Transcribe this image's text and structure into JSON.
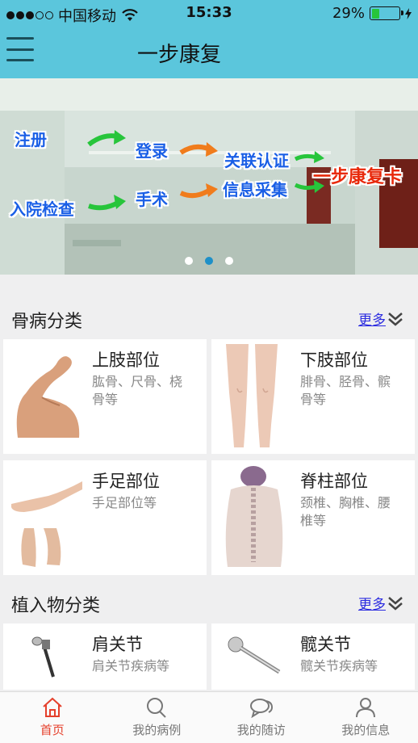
{
  "status_bar": {
    "carrier": "中国移动",
    "time": "15:33",
    "battery": "29%",
    "battery_level": 0.29
  },
  "header": {
    "title": "一步康复"
  },
  "banner": {
    "steps": [
      "注册",
      "登录",
      "入院检查",
      "手术",
      "关联认证",
      "信息采集",
      "一步康复卡"
    ],
    "pages": 3,
    "active_page": 2
  },
  "sections": [
    {
      "title": "骨病分类",
      "more": "更多",
      "cards": [
        {
          "title": "上肢部位",
          "desc": "肱骨、尺骨、桡骨等"
        },
        {
          "title": "下肢部位",
          "desc": "腓骨、胫骨、髌骨等"
        },
        {
          "title": "手足部位",
          "desc": "手足部位等"
        },
        {
          "title": "脊柱部位",
          "desc": "颈椎、胸椎、腰椎等"
        }
      ]
    },
    {
      "title": "植入物分类",
      "more": "更多",
      "cards": [
        {
          "title": "肩关节",
          "desc": "肩关节疾病等"
        },
        {
          "title": "髋关节",
          "desc": "髋关节疾病等"
        }
      ]
    }
  ],
  "tabbar": {
    "items": [
      {
        "label": "首页",
        "icon": "home-icon",
        "active": true
      },
      {
        "label": "我的病例",
        "icon": "search-icon"
      },
      {
        "label": "我的随访",
        "icon": "chat-icon"
      },
      {
        "label": "我的信息",
        "icon": "person-icon"
      }
    ]
  },
  "colors": {
    "header": "#5bc6dc",
    "active_tab": "#e5402c",
    "link": "#2b2be0",
    "pager_active": "#1e90c8"
  }
}
